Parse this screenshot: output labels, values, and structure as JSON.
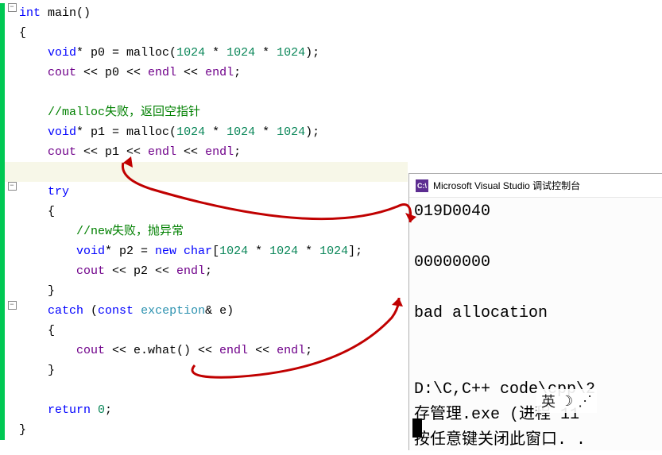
{
  "code": {
    "l1_int": "int",
    "l1_main": " main()",
    "l2": "{",
    "l3_void": "void",
    "l3_p0eq": "* p0 = ",
    "l3_malloc": "malloc",
    "l3_open": "(",
    "l3_n1": "1024",
    "l3_mul": " * ",
    "l3_n2": "1024",
    "l3_n3": "1024",
    "l3_close": ");",
    "l4_cout": "cout",
    "l4_rest": " << p0 << ",
    "l4_endl1": "endl",
    "l4_mid": " << ",
    "l4_endl2": "endl",
    "l4_semi": ";",
    "l5_comment": "//malloc失败，返回空指针",
    "l6_void": "void",
    "l6_p1eq": "* p1 = ",
    "l6_malloc": "malloc",
    "l7_cout": "cout",
    "l7_rest": " << p1 << ",
    "l7_endl": "endl",
    "l8_try": "try",
    "l9": "{",
    "l10_comment": "//new失败，抛异常",
    "l11_void": "void",
    "l11_p2eq": "* p2 = ",
    "l11_new": "new",
    "l11_char": " char",
    "l11_open": "[",
    "l11_close": "];",
    "l12_cout": "cout",
    "l12_rest": " << p2 << ",
    "l12_endl": "endl",
    "l12_semi": ";",
    "l13": "}",
    "l14_catch": "catch",
    "l14_open": " (",
    "l14_const": "const",
    "l14_sp": " ",
    "l14_exc": "exception",
    "l14_rest": "& e)",
    "l15": "{",
    "l16_cout": "cout",
    "l16_rest": " << e.what() << ",
    "l16_endl": "endl",
    "l16_semi": ";",
    "l17": "}",
    "l18_return": "return",
    "l18_sp": " ",
    "l18_zero": "0",
    "l18_semi": ";",
    "l19": "}"
  },
  "console": {
    "title": "Microsoft Visual Studio 调试控制台",
    "r1": "019D0040",
    "r2": "",
    "r3": "00000000",
    "r4": "",
    "r5": "bad allocation",
    "r6": "",
    "r7": "",
    "r8": "D:\\C,C++ code\\cpp\\2",
    "r9": "存管理.exe (进程 11",
    "r10": "按任意键关闭此窗口. ."
  },
  "ime": {
    "lang": "英",
    "mode": "☽",
    "dots": "⋰"
  },
  "icons": {
    "vs": "⊞"
  }
}
